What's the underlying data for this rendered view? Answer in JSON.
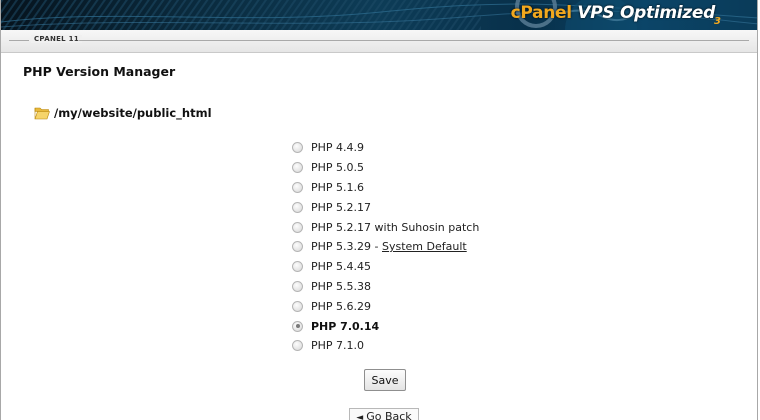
{
  "header": {
    "brand": "cPanel",
    "brand_suffix": "VPS Optimized",
    "brand_version": "3",
    "product_tag": "CPANEL 11"
  },
  "page": {
    "title": "PHP Version Manager",
    "directory": "/my/website/public_html",
    "icons": {
      "folder": "open-folder-icon"
    }
  },
  "php_versions": [
    {
      "label": "PHP 4.4.9",
      "selected": false
    },
    {
      "label": "PHP 5.0.5",
      "selected": false
    },
    {
      "label": "PHP 5.1.6",
      "selected": false
    },
    {
      "label": "PHP 5.2.17",
      "selected": false
    },
    {
      "label": "PHP 5.2.17 with Suhosin patch",
      "selected": false
    },
    {
      "label": "PHP 5.3.29",
      "separator": " - ",
      "default_label": "System Default",
      "selected": false
    },
    {
      "label": "PHP 5.4.45",
      "selected": false
    },
    {
      "label": "PHP 5.5.38",
      "selected": false
    },
    {
      "label": "PHP 5.6.29",
      "selected": false
    },
    {
      "label": "PHP 7.0.14",
      "selected": true
    },
    {
      "label": "PHP 7.1.0",
      "selected": false
    }
  ],
  "actions": {
    "save_label": "Save",
    "go_back_label": "Go Back",
    "go_back_icon": "left-arrow-icon"
  }
}
